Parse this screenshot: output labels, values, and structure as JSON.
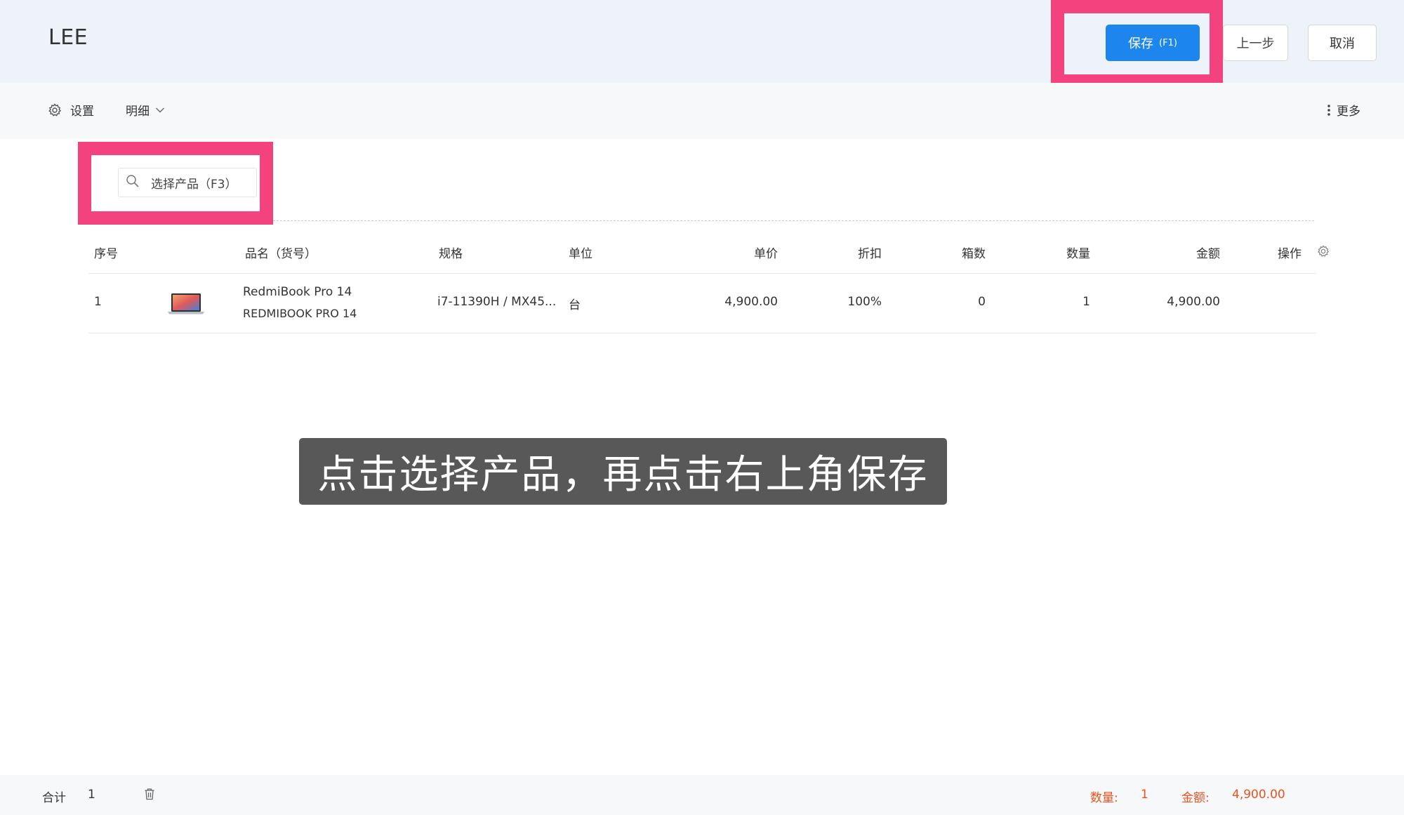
{
  "header": {
    "title": "LEE",
    "save_label": "保存",
    "save_hotkey": "(F1)",
    "prev_label": "上一步",
    "cancel_label": "取消"
  },
  "toolbar": {
    "settings_label": "设置",
    "detail_label": "明细",
    "more_label": "更多"
  },
  "search": {
    "label": "选择产品（F3）"
  },
  "table": {
    "columns": [
      "序号",
      "品名（货号）",
      "规格",
      "单位",
      "单价",
      "折扣",
      "箱数",
      "数量",
      "金额",
      "操作"
    ],
    "rows": [
      {
        "index": "1",
        "name": "RedmiBook Pro 14",
        "code": "REDMIBOOK PRO 14",
        "spec": "i7-11390H / MX45...",
        "unit": "台",
        "price": "4,900.00",
        "discount": "100%",
        "boxes": "0",
        "quantity": "1",
        "amount": "4,900.00"
      }
    ]
  },
  "subtitle": "点击选择产品，再点击右上角保存",
  "footer": {
    "total_label": "合计",
    "total_count": "1",
    "qty_label": "数量:",
    "qty_value": "1",
    "amount_label": "金额:",
    "amount_value": "4,900.00"
  },
  "colors": {
    "primary": "#1c86ee",
    "highlight": "#f4427f",
    "header_bg": "#eef2f9",
    "footer_accent": "#e8531f"
  }
}
